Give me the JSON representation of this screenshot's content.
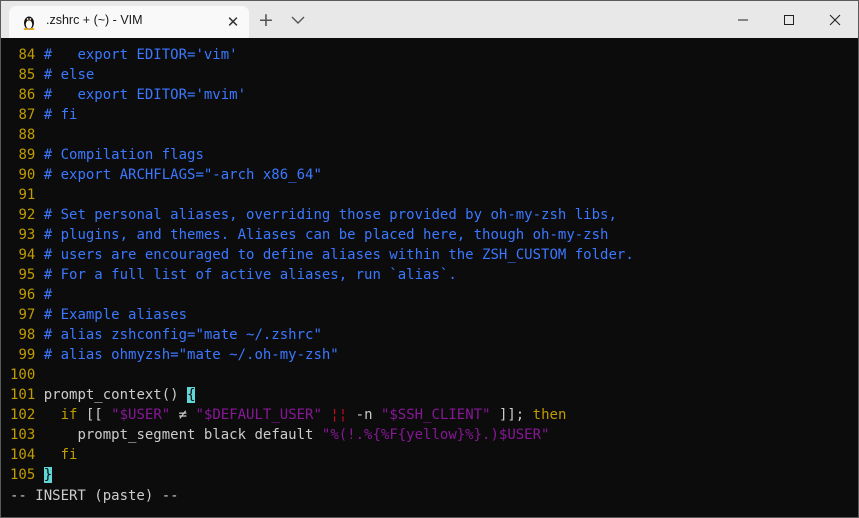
{
  "window": {
    "tab_title": ".zshrc + (~) - VIM",
    "tab_icon": "linux-penguin-icon",
    "close_glyph": "✕",
    "new_tab_glyph": "+"
  },
  "editor": {
    "lines": [
      {
        "num": "84",
        "text": "#   export EDITOR='vim'"
      },
      {
        "num": "85",
        "text": "# else"
      },
      {
        "num": "86",
        "text": "#   export EDITOR='mvim'"
      },
      {
        "num": "87",
        "text": "# fi"
      },
      {
        "num": "88",
        "text": ""
      },
      {
        "num": "89",
        "text": "# Compilation flags"
      },
      {
        "num": "90",
        "text": "# export ARCHFLAGS=\"-arch x86_64\""
      },
      {
        "num": "91",
        "text": ""
      },
      {
        "num": "92",
        "text": "# Set personal aliases, overriding those provided by oh-my-zsh libs,"
      },
      {
        "num": "93",
        "text": "# plugins, and themes. Aliases can be placed here, though oh-my-zsh"
      },
      {
        "num": "94",
        "text": "# users are encouraged to define aliases within the ZSH_CUSTOM folder."
      },
      {
        "num": "95",
        "text": "# For a full list of active aliases, run `alias`."
      },
      {
        "num": "96",
        "text": "#"
      },
      {
        "num": "97",
        "text": "# Example aliases"
      },
      {
        "num": "98",
        "text": "# alias zshconfig=\"mate ~/.zshrc\""
      },
      {
        "num": "99",
        "text": "# alias ohmyzsh=\"mate ~/.oh-my-zsh\""
      },
      {
        "num": "100",
        "text": ""
      }
    ],
    "code": {
      "l101": {
        "num": "101",
        "fn": "prompt_context() ",
        "cursor": "{"
      },
      "l102": {
        "num": "102",
        "indent": "  ",
        "if_kw": "if",
        "open": " [[ ",
        "s1": "\"$USER\"",
        "ne": " ≠ ",
        "s2": "\"$DEFAULT_USER\"",
        "or": " ¦¦ ",
        "flag": "-n ",
        "s3": "\"$SSH_CLIENT\"",
        "close": " ]]; ",
        "then_kw": "then"
      },
      "l103": {
        "num": "103",
        "indent": "    ",
        "cmd": "prompt_segment black default ",
        "s1": "\"%(!.%{%F{yellow}%}.)$USER\""
      },
      "l104": {
        "num": "104",
        "indent": "  ",
        "fi_kw": "fi"
      },
      "l105": {
        "num": "105",
        "cursor": "}"
      }
    },
    "status": "-- INSERT (paste) --"
  },
  "colors": {
    "line_number": "#c19c00",
    "comment": "#3b78ff",
    "string": "#881798",
    "keyword": "#c19c00",
    "cursor": "#61d6d6",
    "background": "#0c0c0c"
  }
}
